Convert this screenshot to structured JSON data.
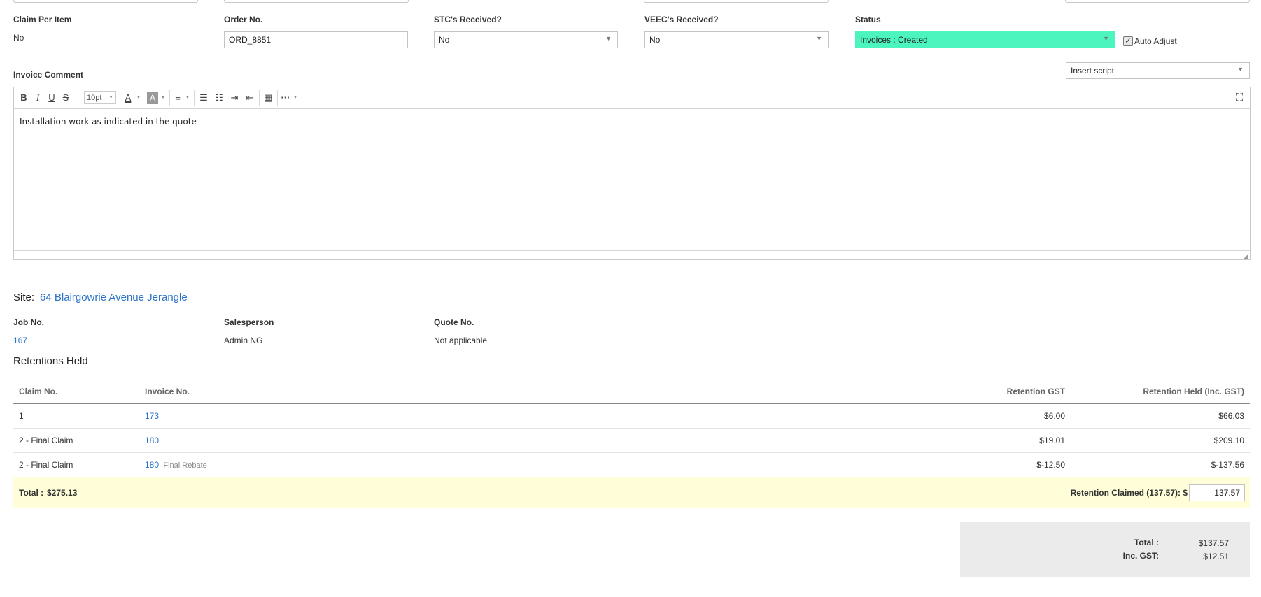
{
  "fields": {
    "claim_per_item": {
      "label": "Claim Per Item",
      "value": "No"
    },
    "order_no": {
      "label": "Order No.",
      "value": "ORD_8851"
    },
    "stc_received": {
      "label": "STC's Received?",
      "value": "No"
    },
    "veec_received": {
      "label": "VEEC's Received?",
      "value": "No"
    },
    "status": {
      "label": "Status",
      "value": "Invoices : Created",
      "color": "#4cf5be"
    },
    "auto_adjust": {
      "label": "Auto Adjust",
      "checked": true
    }
  },
  "invoice_comment": {
    "label": "Invoice Comment",
    "insert_script": "Insert script",
    "font_size": "10pt",
    "content": "Installation work as indicated in the quote"
  },
  "site": {
    "label": "Site:",
    "address": "64 Blairgowrie Avenue Jerangle",
    "job_no_label": "Job No.",
    "job_no": "167",
    "salesperson_label": "Salesperson",
    "salesperson": "Admin NG",
    "quote_no_label": "Quote No.",
    "quote_no": "Not applicable"
  },
  "retentions": {
    "title": "Retentions Held",
    "headers": [
      "Claim No.",
      "Invoice No.",
      "Retention GST",
      "Retention Held (Inc. GST)"
    ],
    "rows": [
      {
        "claim": "1",
        "invoice": "173",
        "note": "",
        "gst": "$6.00",
        "held": "$66.03"
      },
      {
        "claim": "2 - Final Claim",
        "invoice": "180",
        "note": "",
        "gst": "$19.01",
        "held": "$209.10"
      },
      {
        "claim": "2 - Final Claim",
        "invoice": "180",
        "note": "Final Rebate",
        "gst": "$-12.50",
        "held": "$-137.56"
      }
    ],
    "total_label": "Total :",
    "total_value": "$275.13",
    "claimed_label": "Retention Claimed (137.57): $",
    "claimed_value": "137.57"
  },
  "summary": {
    "total_label": "Total :",
    "total_value": "$137.57",
    "gst_label": "Inc. GST:",
    "gst_value": "$12.51"
  }
}
